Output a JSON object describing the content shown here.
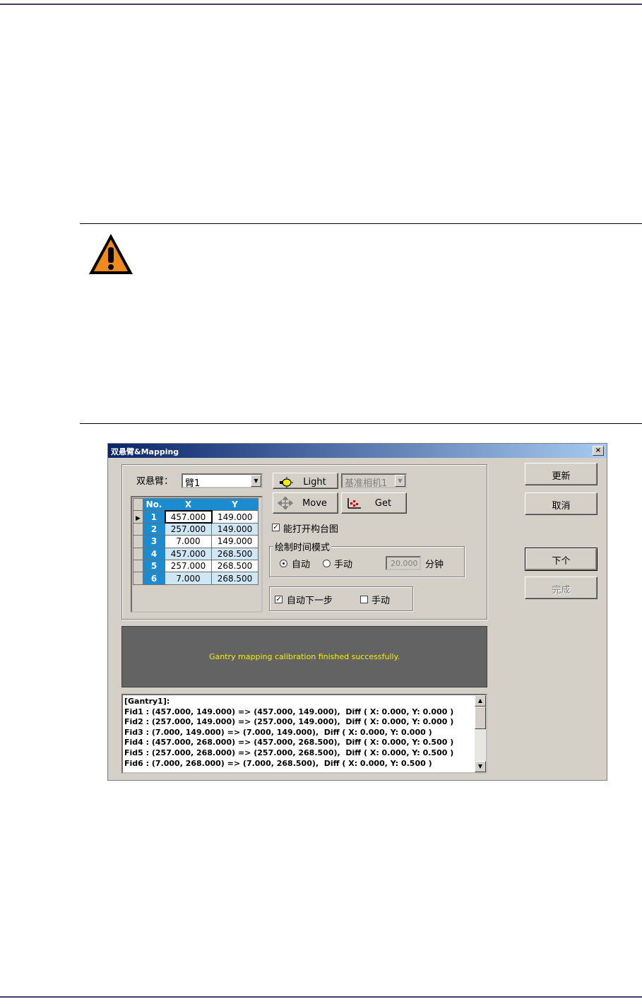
{
  "dialog": {
    "title": "双悬臂&Mapping",
    "close_glyph": "×"
  },
  "gantry": {
    "label": "双悬臂：",
    "selected": "臂1"
  },
  "camera": {
    "selected": "基准相机1"
  },
  "buttons": {
    "light": "Light",
    "move": "Move",
    "get": "Get",
    "update": "更新",
    "cancel": "取消",
    "next": "下个",
    "finish": "完成"
  },
  "table": {
    "headers": [
      "No.",
      "X",
      "Y"
    ],
    "rows": [
      {
        "no": "1",
        "x": "457.000",
        "y": "149.000"
      },
      {
        "no": "2",
        "x": "257.000",
        "y": "149.000"
      },
      {
        "no": "3",
        "x": "7.000",
        "y": "149.000"
      },
      {
        "no": "4",
        "x": "457.000",
        "y": "268.500"
      },
      {
        "no": "5",
        "x": "257.000",
        "y": "268.500"
      },
      {
        "no": "6",
        "x": "7.000",
        "y": "268.500"
      }
    ]
  },
  "options": {
    "open_map": "能打开构台图",
    "open_map_checked": true,
    "draw_mode_group": "绘制时间模式",
    "auto": "自动",
    "manual": "手动",
    "auto_selected": true,
    "minutes_value": "20.000",
    "minutes_unit": "分钟",
    "auto_next": "自动下一步",
    "auto_next_checked": true,
    "manual_step": "手动",
    "manual_step_checked": false
  },
  "status": {
    "message": "Gantry mapping calibration finished successfully."
  },
  "log": {
    "lines": [
      "[Gantry1]:",
      "Fid1 : (457.000, 149.000) => (457.000, 149.000),  Diff ( X: 0.000, Y: 0.000 )",
      "Fid2 : (257.000, 149.000) => (257.000, 149.000),  Diff ( X: 0.000, Y: 0.000 )",
      "Fid3 : (7.000, 149.000) => (7.000, 149.000),  Diff ( X: 0.000, Y: 0.000 )",
      "Fid4 : (457.000, 268.000) => (457.000, 268.500),  Diff ( X: 0.000, Y: 0.500 )",
      "Fid5 : (257.000, 268.000) => (257.000, 268.500),  Diff ( X: 0.000, Y: 0.500 )",
      "Fid6 : (7.000, 268.000) => (7.000, 268.500),  Diff ( X: 0.000, Y: 0.500 )"
    ]
  },
  "colors": {
    "warning_fill": "#f08a1c",
    "grid_header": "#1a8ccf",
    "status_bg": "#636363",
    "status_text": "#f3f000"
  }
}
